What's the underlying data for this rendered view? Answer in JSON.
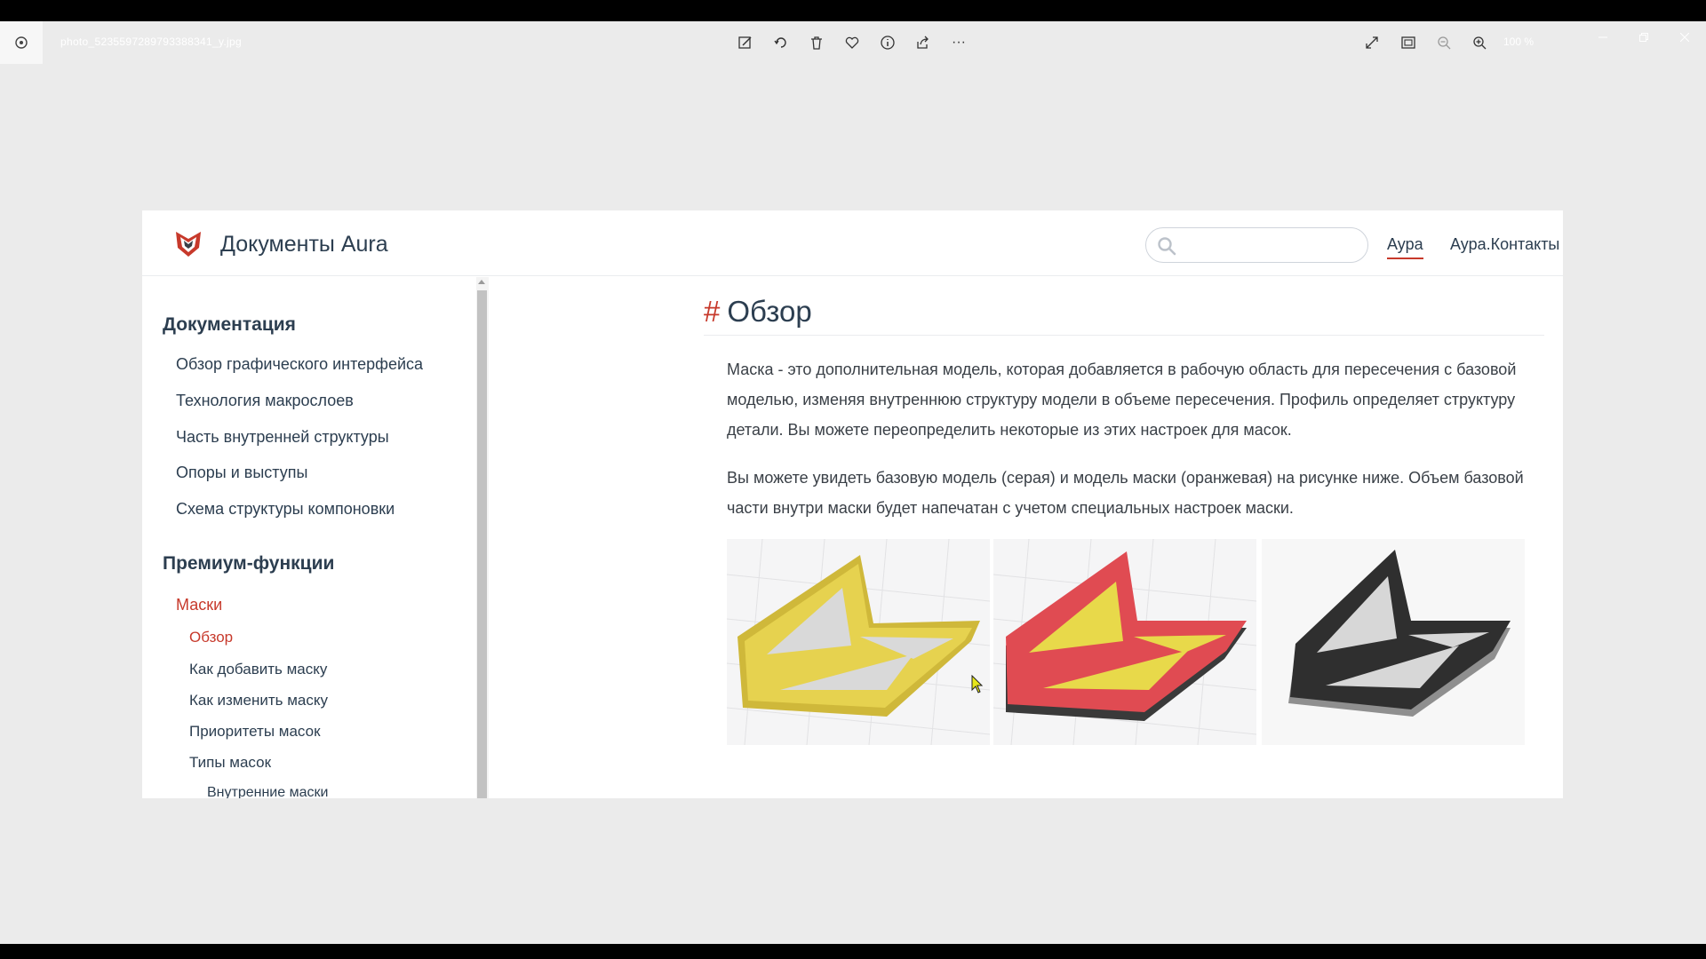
{
  "viewer": {
    "file_name": "photo_5235597289793388341_y.jpg",
    "zoom_level": "100 %",
    "icons": {
      "app": "photos-app-icon",
      "edit": "edit-image-icon",
      "rotate": "rotate-icon",
      "delete": "trash-icon",
      "favorite": "heart-icon",
      "info": "info-icon",
      "share": "share-icon",
      "more": "more-icon",
      "fullscreen": "fullscreen-icon",
      "fit": "fit-screen-icon",
      "zoom_out": "zoom-out-icon",
      "zoom_in": "zoom-in-icon"
    },
    "more_label": "···"
  },
  "site": {
    "title": "Документы Aura",
    "search_placeholder": "",
    "nav": [
      "Аура",
      "Аура.Контакты"
    ],
    "accent_color": "#c7392b"
  },
  "sidebar": {
    "section1_title": "Документация",
    "section1_items": [
      "Обзор графического интерфейса",
      "Технология макрослоев",
      "Часть внутренней структуры",
      "Опоры и выступы",
      "Схема структуры компоновки"
    ],
    "section2_title": "Премиум-функции",
    "section2_item": "Маски",
    "subitems": [
      "Обзор",
      "Как добавить маску",
      "Как изменить маску",
      "Приоритеты масок",
      "Типы масок"
    ],
    "subsubitem": "Внутренние маски"
  },
  "main": {
    "title": "Обзор",
    "hash": "#",
    "paragraph1": "Маска - это дополнительная модель, которая добавляется в рабочую область для пересечения с базовой моделью, изменяя внутреннюю структуру модели в объеме пересечения. Профиль определяет структуру детали. Вы можете переопределить некоторые из этих настроек для масок.",
    "paragraph2": "Вы можете увидеть базовую модель (серая) и модель маски (оранжевая) на рисунке ниже. Объем базовой части внутри маски будет напечатан с учетом специальных настроек маски."
  }
}
